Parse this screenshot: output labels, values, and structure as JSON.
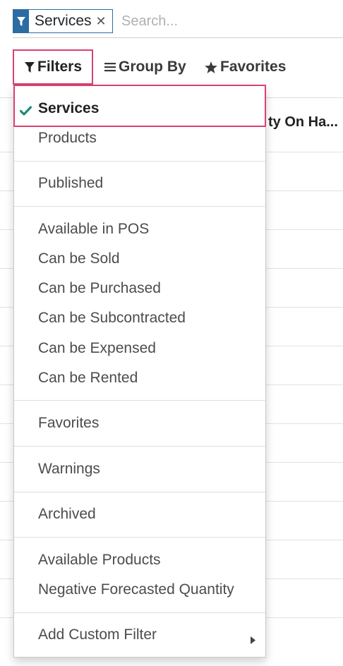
{
  "search": {
    "facet_label": "Services",
    "placeholder": "Search..."
  },
  "toolbar": {
    "filters_label": "Filters",
    "group_by_label": "Group By",
    "favorites_label": "Favorites"
  },
  "background": {
    "column_header": "ty On Ha..."
  },
  "filters_menu": {
    "items": [
      {
        "label": "Services",
        "checked": true
      },
      {
        "label": "Products"
      },
      {
        "label": "Published"
      },
      {
        "label": "Available in POS"
      },
      {
        "label": "Can be Sold"
      },
      {
        "label": "Can be Purchased"
      },
      {
        "label": "Can be Subcontracted"
      },
      {
        "label": "Can be Expensed"
      },
      {
        "label": "Can be Rented"
      },
      {
        "label": "Favorites"
      },
      {
        "label": "Warnings"
      },
      {
        "label": "Archived"
      },
      {
        "label": "Available Products"
      },
      {
        "label": "Negative Forecasted Quantity"
      },
      {
        "label": "Add Custom Filter"
      }
    ]
  },
  "colors": {
    "facet_accent": "#2b6ca3",
    "highlight_border": "#d9416f",
    "check_color": "#1f8a7a"
  },
  "icons": {
    "facet": "filter-icon",
    "remove": "close-icon",
    "filters": "filter-icon",
    "group_by": "bars-icon",
    "favorites": "star-icon",
    "selected": "check-icon",
    "custom_filter": "caret-right-icon"
  }
}
